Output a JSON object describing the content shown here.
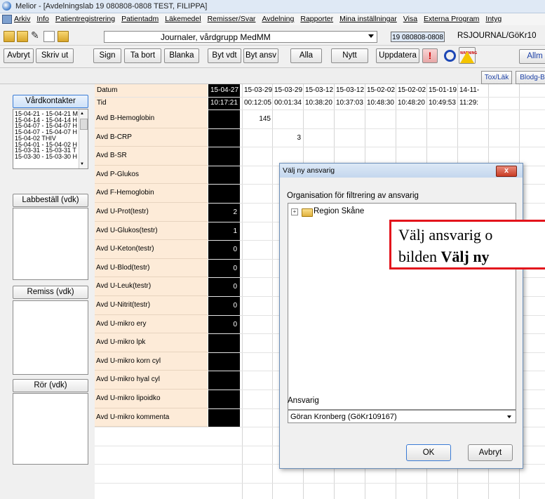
{
  "window": {
    "title": "Melior - [Avdelningslab 19 080808-0808 TEST, FILIPPA]"
  },
  "menu": {
    "items": [
      "Arkiv",
      "Info",
      "Patientregistrering",
      "Patientadm",
      "Läkemedel",
      "Remisser/Svar",
      "Avdelning",
      "Rapporter",
      "Mina inställningar",
      "Visa",
      "Externa Program",
      "Intyg"
    ]
  },
  "toolbar": {
    "journal_combo": "Journaler, vårdgrupp MedMM",
    "patient_id": "19 080808-0808",
    "rsj_label": "RSJOURNAL/GöKr10"
  },
  "buttons": {
    "avbryt": "Avbryt",
    "skriv_ut": "Skriv ut",
    "sign": "Sign",
    "ta_bort": "Ta bort",
    "blanka": "Blanka",
    "byt_vdt": "Byt vdt",
    "byt_ansv": "Byt ansv",
    "alla": "Alla",
    "nytt": "Nytt",
    "uppdatera": "Uppdatera",
    "excl": "!",
    "warning": "WARNING",
    "allm": "Allm",
    "tox_lak": "Tox/Läk",
    "blodg": "Blodg-B"
  },
  "left": {
    "vardkontakter_btn": "Vårdkontakter",
    "vardkontakter_items": [
      "15-04-21 - 15-04-21 M",
      "15-04-14 - 15-04-14 H",
      "15-04-07 - 15-04-07 H",
      "15-04-07 - 15-04-07 H",
      "15-04-02        THIV",
      "15-04-01 - 15-04-02 H",
      "15-03-31 - 15-03-31 T",
      "15-03-30 - 15-03-30 H"
    ],
    "labbestall_btn": "Labbeställ (vdk)",
    "remiss_btn": "Remiss (vdk)",
    "ror_btn": "Rör (vdk)"
  },
  "grid": {
    "datum_label": "Datum",
    "tid_label": "Tid",
    "dates": [
      "15-04-27",
      "15-03-29",
      "15-03-29",
      "15-03-12",
      "15-03-12",
      "15-02-02",
      "15-02-02",
      "15-01-19",
      "14-11-"
    ],
    "times": [
      "10:17:21",
      "00:12:05",
      "00:01:34",
      "10:38:20",
      "10:37:03",
      "10:48:30",
      "10:48:20",
      "10:49:53",
      "11:29:"
    ],
    "rows": [
      {
        "label": "Avd B-Hemoglobin",
        "v0": "",
        "v1": "145"
      },
      {
        "label": "Avd B-CRP",
        "v0": "",
        "v1": "",
        "v2": "3"
      },
      {
        "label": "Avd B-SR",
        "v0": ""
      },
      {
        "label": "Avd P-Glukos",
        "v0": ""
      },
      {
        "label": "Avd F-Hemoglobin",
        "v0": ""
      },
      {
        "label": "Avd U-Prot(testr)",
        "v0": "2"
      },
      {
        "label": "Avd U-Glukos(testr)",
        "v0": "1"
      },
      {
        "label": "Avd U-Keton(testr)",
        "v0": "0"
      },
      {
        "label": "Avd U-Blod(testr)",
        "v0": "0"
      },
      {
        "label": "Avd U-Leuk(testr)",
        "v0": "0"
      },
      {
        "label": "Avd U-Nitrit(testr)",
        "v0": "0"
      },
      {
        "label": "Avd U-mikro ery",
        "v0": "0"
      },
      {
        "label": "Avd U-mikro lpk",
        "v0": ""
      },
      {
        "label": "Avd U-mikro korn cyl",
        "v0": ""
      },
      {
        "label": "Avd U-mikro hyal cyl",
        "v0": ""
      },
      {
        "label": "Avd U-mikro lipoidko",
        "v0": ""
      },
      {
        "label": "Avd U-mikro kommenta",
        "v0": ""
      }
    ]
  },
  "dialog": {
    "title": "Välj ny ansvarig",
    "close": "x",
    "org_label": "Organisation för filtrering av ansvarig",
    "tree_root": "Region Skåne",
    "ansvarig_label": "Ansvarig",
    "ansvarig_value": "Göran Kronberg (GöKr109167)",
    "ok": "OK",
    "cancel": "Avbryt"
  },
  "callout": {
    "line1": "Välj ansvarig o",
    "line2_a": "bilden ",
    "line2_b": "Välj ny"
  }
}
